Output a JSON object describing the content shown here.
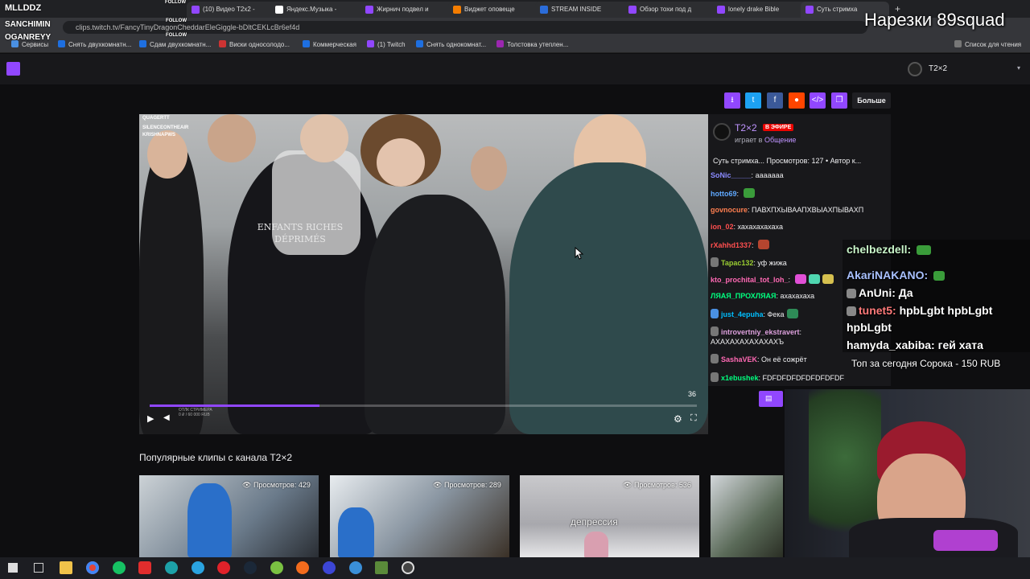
{
  "browser": {
    "tabs": [
      {
        "title": "(10) Видео T2x2 -",
        "color": "#9147ff"
      },
      {
        "title": "Яндекс.Музыка -",
        "color": "#ffffff"
      },
      {
        "title": "Жирнич подвел и",
        "color": "#9147ff"
      },
      {
        "title": "Виджет оповеще",
        "color": "#f57d00"
      },
      {
        "title": "STREAM INSIDE",
        "color": "#2b6cd9"
      },
      {
        "title": "Обзор тохи под д",
        "color": "#9147ff"
      },
      {
        "title": "lonely drake Bible",
        "color": "#9147ff"
      },
      {
        "title": "Суть стримха",
        "color": "#9147ff"
      }
    ],
    "url": "clips.twitch.tv/FancyTinyDragonCheddarEleGiggle-bDltCEKLcBr6ef4d",
    "bookmarks": [
      {
        "label": "Сервисы",
        "color": "#4a90e2"
      },
      {
        "label": "Снять двухкомнатн...",
        "color": "#1e6fe0"
      },
      {
        "label": "Сдам двухкомнатн...",
        "color": "#1e6fe0"
      },
      {
        "label": "Виски односолодо...",
        "color": "#cc3333"
      },
      {
        "label": "Коммерческая",
        "color": "#1e6fe0"
      },
      {
        "label": "(1) Twitch",
        "color": "#9147ff"
      },
      {
        "label": "Снять однокомнат...",
        "color": "#1e6fe0"
      },
      {
        "label": "Толстовка утеплен...",
        "color": "#9c27b0"
      }
    ],
    "reading_list": "Список для чтения"
  },
  "stream_overlay": {
    "title": "Нарезки 89squad",
    "followers": [
      "MLLDDZ",
      "SANCHIMIN",
      "OGANREYY"
    ],
    "follow_label": "FOLLOW",
    "top_donor": "Топ за сегодня Сорока - 150 RUB"
  },
  "twitch": {
    "channel_top": "T2×2",
    "more_label": "Больше",
    "share_colors": [
      "#9147ff",
      "#1da1f2",
      "#3b5998",
      "#ff4500",
      "#9147ff",
      "#9147ff"
    ],
    "streamer": "T2×2",
    "live_label": "В ЭФИРЕ",
    "playing_prefix": "играет в",
    "game": "Общение",
    "clip_meta": "Суть стримха...  Просмотров: 127  •  Автор к...",
    "timecode": "36",
    "progress": 0.31,
    "popular_title": "Популярные клипы с канала T2×2",
    "clips": [
      {
        "views": "Просмотров: 429"
      },
      {
        "views": "Просмотров: 289"
      },
      {
        "views": "Просмотров: 536",
        "caption": "депрессия"
      }
    ]
  },
  "chat": [
    {
      "user": "SoNic_____",
      "color": "#8a8aff",
      "text": "ааааааа"
    },
    {
      "user": "hotto69",
      "color": "#5fa8ff",
      "text": "",
      "emote": "#3a9c3a"
    },
    {
      "user": "govnocure",
      "color": "#ff7f50",
      "text": "ПАВХПХЫВААПХВЫАХПЫВАХП"
    },
    {
      "user": "ion_02",
      "color": "#ff4f4f",
      "text": "хахахахахаха"
    },
    {
      "user": "rXahhd1337",
      "color": "#ff4f4f",
      "text": "",
      "emote": "#b5452f"
    },
    {
      "user": "Tapac132",
      "color": "#9acd32",
      "text": "уф жижа"
    },
    {
      "user": "kto_prochital_tot_loh_",
      "color": "#ff69b4",
      "text": ""
    },
    {
      "user": "ЛЯАЯ_ПРОХЛЯАЯ",
      "color": "#00ff7f",
      "text": "ахахахаха"
    },
    {
      "user": "just_4epuha",
      "color": "#00bfff",
      "text": "Фека"
    },
    {
      "user": "introvertniy_ekstravert",
      "color": "#dda0dd",
      "text": ""
    },
    {
      "user": "",
      "color": "#efeff1",
      "text": "АХАХАХАХАХАХАХЪ"
    },
    {
      "user": "SashaVEK",
      "color": "#ff69b4",
      "text": "Он её сожрёт"
    },
    {
      "user": "x1ebushek",
      "color": "#00ff7f",
      "text": "FDFDFDFDFDFDFDFDF"
    }
  ],
  "overlay_chat": [
    {
      "user": "chelbezdell:",
      "color": "#c9f5c9",
      "text": ""
    },
    {
      "user": "AkariNAKANO:",
      "color": "#a9c1ff",
      "text": ""
    },
    {
      "user": "AnUni:",
      "color": "#ffffff",
      "text": "Да"
    },
    {
      "user": "tunet5:",
      "color": "#ff7a7a",
      "text": "hpbLgbt hpbLgbt"
    },
    {
      "user": "",
      "color": "#ffffff",
      "text": "hpbLgbt"
    },
    {
      "user": "hamyda_xabiba:",
      "color": "#ffffff",
      "text": "гей хата"
    }
  ]
}
